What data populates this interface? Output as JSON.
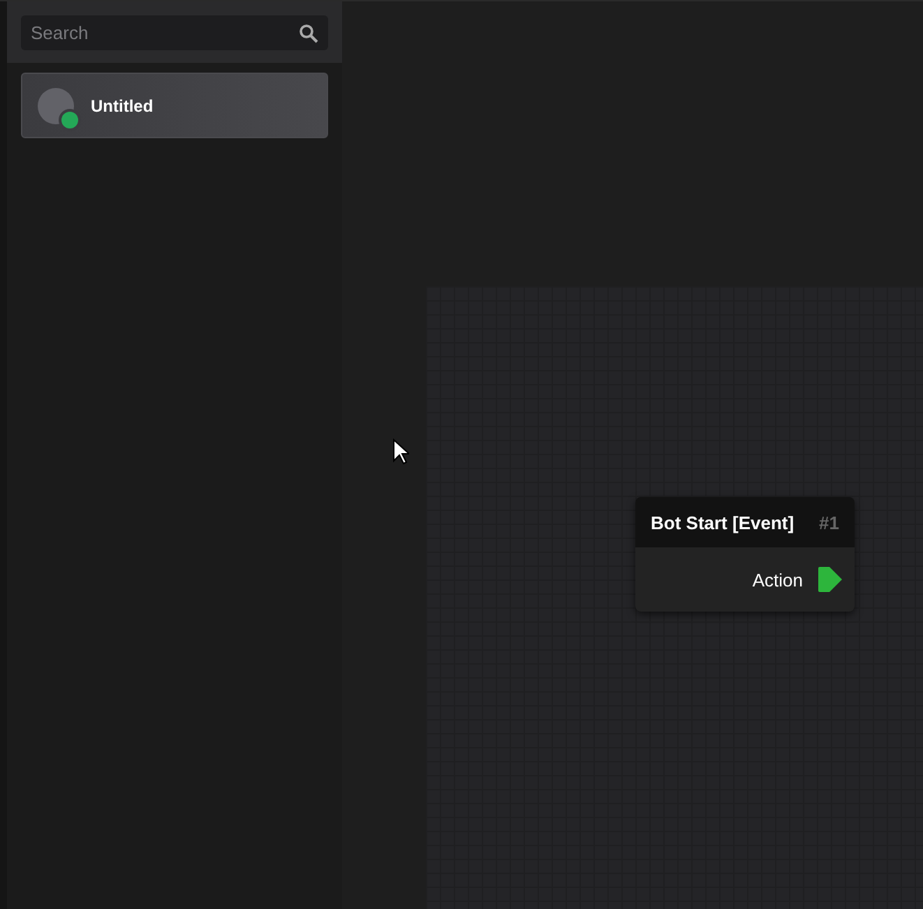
{
  "sidebar": {
    "search": {
      "placeholder": "Search"
    },
    "items": [
      {
        "name": "Untitled",
        "selected": true,
        "online": true
      }
    ]
  },
  "canvas": {
    "nodes": [
      {
        "title": "Bot Start [Event]",
        "number": "#1",
        "outputs": [
          {
            "label": "Action"
          }
        ]
      }
    ]
  }
}
